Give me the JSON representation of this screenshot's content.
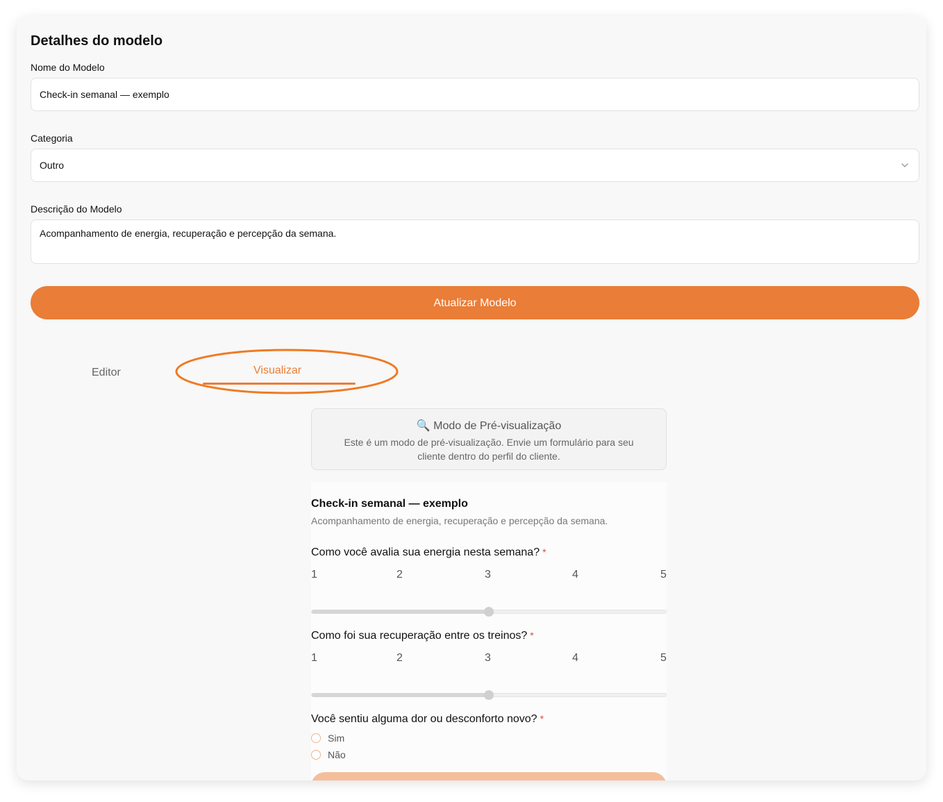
{
  "details": {
    "section_title": "Detalhes do modelo",
    "name_label": "Nome do Modelo",
    "name_value": "Check-in semanal — exemplo",
    "category_label": "Categoria",
    "category_value": "Outro",
    "description_label": "Descrição do Modelo",
    "description_value": "Acompanhamento de energia, recuperação e percepção da semana.",
    "update_button": "Atualizar Modelo"
  },
  "tabs": {
    "editor": "Editor",
    "preview": "Visualizar",
    "active": "preview"
  },
  "preview_notice": {
    "icon": "magnifier-icon",
    "title": "🔍 Modo de Pré-visualização",
    "text": "Este é um modo de pré-visualização. Envie um formulário para seu cliente dentro do perfil do cliente."
  },
  "form": {
    "title": "Check-in semanal — exemplo",
    "description": "Acompanhamento de energia, recuperação e percepção da semana.",
    "questions": [
      {
        "label": "Como você avalia sua energia nesta semana?",
        "required_mark": "*",
        "scale": [
          "1",
          "2",
          "3",
          "4",
          "5"
        ],
        "value": 3
      },
      {
        "label": "Como foi sua recuperação entre os treinos?",
        "required_mark": "*",
        "scale": [
          "1",
          "2",
          "3",
          "4",
          "5"
        ],
        "value": 3
      },
      {
        "label": "Você sentiu alguma dor ou desconforto novo?",
        "required_mark": "*",
        "options": [
          "Sim",
          "Não"
        ]
      }
    ]
  },
  "colors": {
    "accent": "#ea7d37",
    "required": "#e24b3b"
  }
}
